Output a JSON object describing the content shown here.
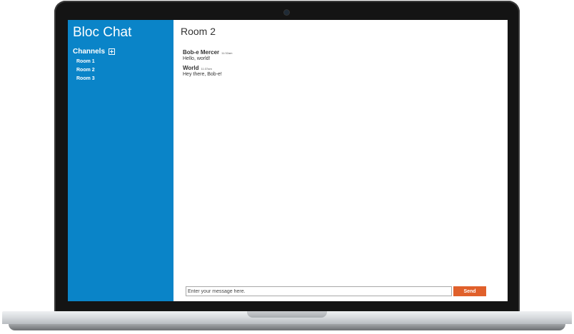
{
  "sidebar": {
    "brand": "Bloc Chat",
    "channels_label": "Channels",
    "add_icon": "plus-square-icon",
    "rooms": [
      {
        "label": "Room 1"
      },
      {
        "label": "Room 2"
      },
      {
        "label": "Room 3"
      }
    ]
  },
  "main": {
    "room_title": "Room 2",
    "messages": [
      {
        "username": "Bob-e Mercer",
        "time": "11:32am",
        "content": "Hello, world!"
      },
      {
        "username": "World",
        "time": "11:37am",
        "content": "Hey there, Bob-e!"
      }
    ],
    "composer": {
      "placeholder": "Enter your message here.",
      "value": "",
      "send_label": "Send"
    }
  },
  "colors": {
    "sidebar_bg": "#0a84c8",
    "send_button": "#e0602b"
  }
}
